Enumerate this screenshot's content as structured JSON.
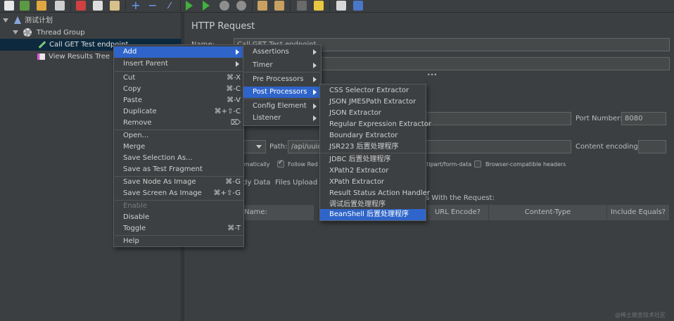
{
  "toolbar": {
    "icons": [
      "new-icon",
      "templates-icon",
      "open-icon",
      "save-icon",
      "cut-icon",
      "copy-icon",
      "paste-icon",
      "expand-icon",
      "collapse-icon",
      "toggle-icon",
      "start-icon",
      "start-no-pause-icon",
      "stop-icon",
      "shutdown-icon",
      "clear-icon",
      "clear-all-icon",
      "search-icon",
      "reset-search-icon",
      "function-helper-icon",
      "help-icon"
    ]
  },
  "tree": {
    "items": [
      {
        "label": "测试计划"
      },
      {
        "label": "Thread Group"
      },
      {
        "label": "Call GET Test endpoint"
      },
      {
        "label": "View Results Tree"
      }
    ]
  },
  "main": {
    "title": "HTTP Request",
    "name_label": "Name:",
    "name_value": "Call GET Test endpoint",
    "collapse_handle": "•••",
    "port_label": "Port Number:",
    "port_value": "8080",
    "path_label": "Path:",
    "path_value": "/api/uuid",
    "content_encoding_label": "Content encoding:",
    "cb_redirect_auto": "omatically",
    "cb_follow_redirects": "Follow Red",
    "cb_multipart": "ltipart/form-data",
    "cb_browser_headers": "Browser-compatible headers",
    "tab_body": "ody Data",
    "tab_files": "Files Upload",
    "send_params": "s With the Request:",
    "col_name": "Name:",
    "col_url_encode": "URL Encode?",
    "col_content_type": "Content-Type",
    "col_include_equals": "Include Equals?"
  },
  "context_menu": {
    "items": [
      {
        "label": "Add",
        "shortcut": "",
        "submenu": true,
        "highlighted": true
      },
      {
        "label": "Insert Parent",
        "shortcut": "",
        "submenu": true
      },
      {
        "label": "Cut",
        "shortcut": "⌘-X"
      },
      {
        "label": "Copy",
        "shortcut": "⌘-C"
      },
      {
        "label": "Paste",
        "shortcut": "⌘-V"
      },
      {
        "label": "Duplicate",
        "shortcut": "⌘+⇧-C"
      },
      {
        "label": "Remove",
        "shortcut": "⌦"
      },
      {
        "label": "Open..."
      },
      {
        "label": "Merge"
      },
      {
        "label": "Save Selection As..."
      },
      {
        "label": "Save as Test Fragment"
      },
      {
        "label": "Save Node As Image",
        "shortcut": "⌘-G"
      },
      {
        "label": "Save Screen As Image",
        "shortcut": "⌘+⇧-G"
      },
      {
        "label": "Enable",
        "disabled": true
      },
      {
        "label": "Disable"
      },
      {
        "label": "Toggle",
        "shortcut": "⌘-T"
      },
      {
        "label": "Help"
      }
    ]
  },
  "add_menu": {
    "items": [
      {
        "label": "Assertions"
      },
      {
        "label": "Timer"
      },
      {
        "label": "Pre Processors"
      },
      {
        "label": "Post Processors",
        "highlighted": true
      },
      {
        "label": "Config Element"
      },
      {
        "label": "Listener"
      }
    ]
  },
  "post_menu": {
    "items": [
      {
        "label": "CSS Selector Extractor"
      },
      {
        "label": "JSON JMESPath Extractor"
      },
      {
        "label": "JSON Extractor"
      },
      {
        "label": "Regular Expression Extractor"
      },
      {
        "label": "Boundary Extractor"
      },
      {
        "label": "JSR223 后置处理程序"
      },
      {
        "label": "JDBC 后置处理程序"
      },
      {
        "label": "XPath2 Extractor"
      },
      {
        "label": "XPath Extractor"
      },
      {
        "label": "Result Status Action Handler"
      },
      {
        "label": "调试后置处理程序"
      },
      {
        "label": "BeanShell 后置处理程序",
        "highlighted": true
      }
    ]
  },
  "watermark": "@稀土掘金技术社区",
  "colors": {
    "accent": "#2f65ca",
    "background": "#3c3f41",
    "selection": "#0d293e"
  }
}
